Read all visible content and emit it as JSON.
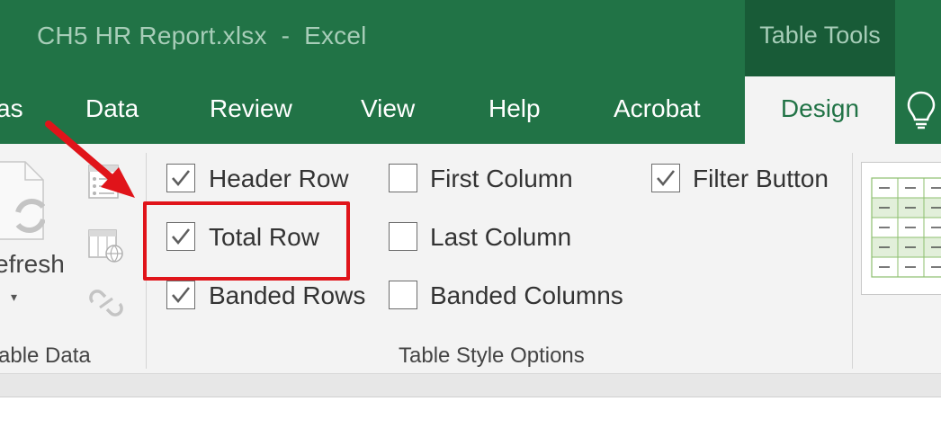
{
  "title_bar": {
    "document_title": "CH5 HR Report.xlsx  -  Excel",
    "context_tab_group": "Table Tools"
  },
  "tabs": {
    "partial_left": "as",
    "data": "Data",
    "review": "Review",
    "view": "View",
    "help": "Help",
    "acrobat": "Acrobat",
    "design": "Design",
    "tell_me_icon": "lightbulb-icon"
  },
  "external_table_data": {
    "refresh_label": "efresh",
    "group_label": "able Data",
    "icons": [
      "refresh-icon",
      "properties-icon",
      "open-in-browser-icon",
      "unlink-icon"
    ]
  },
  "table_style_options": {
    "group_label": "Table Style Options",
    "options": [
      {
        "label": "Header Row",
        "checked": true
      },
      {
        "label": "Total Row",
        "checked": true
      },
      {
        "label": "Banded Rows",
        "checked": true
      },
      {
        "label": "First Column",
        "checked": false
      },
      {
        "label": "Last Column",
        "checked": false
      },
      {
        "label": "Banded Columns",
        "checked": false
      },
      {
        "label": "Filter Button",
        "checked": true
      }
    ]
  },
  "annotation": {
    "highlight_color": "#e0141a",
    "highlighted_option": "Total Row"
  },
  "colors": {
    "ribbon_green": "#217346",
    "context_green": "#185b37",
    "ribbon_background": "#f3f3f3"
  }
}
